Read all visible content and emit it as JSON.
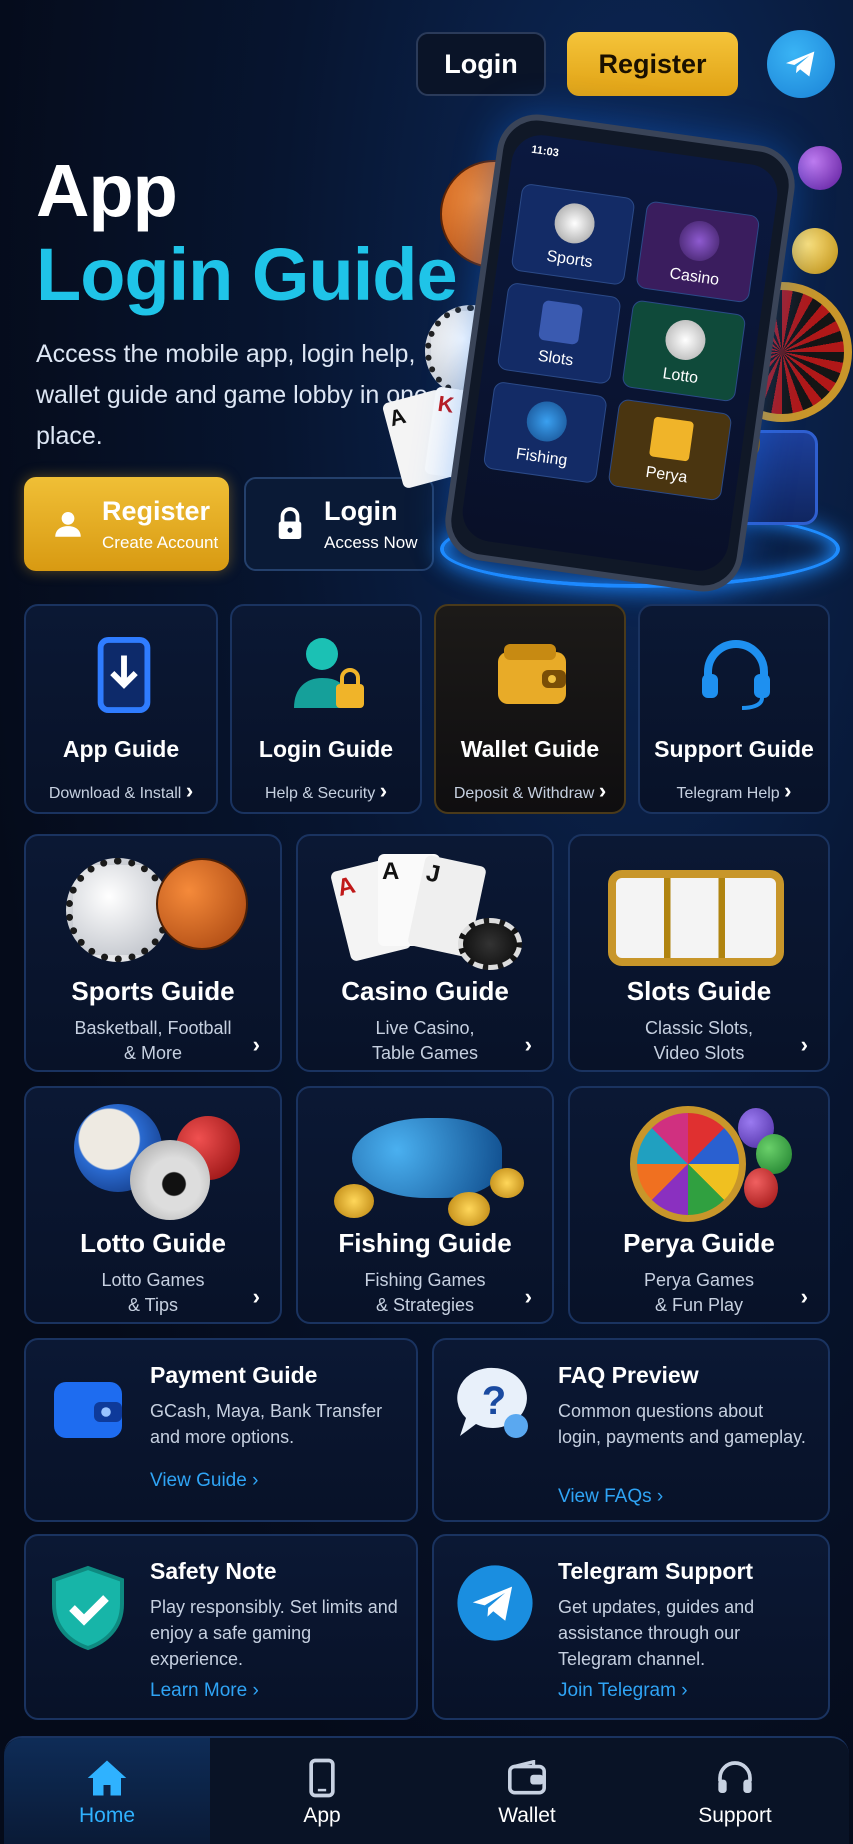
{
  "topbar": {
    "login_label": "Login",
    "register_label": "Register"
  },
  "hero": {
    "title_line1": "App",
    "title_line2": "Login Guide",
    "description": "Access the mobile app, login help, wallet guide and game lobby in one place.",
    "register_button": {
      "label": "Register",
      "sublabel": "Create Account"
    },
    "login_button": {
      "label": "Login",
      "sublabel": "Access Now"
    }
  },
  "phone": {
    "time": "11:03",
    "tiles": [
      "Sports",
      "Casino",
      "Slots",
      "Lotto",
      "Fishing",
      "Perya"
    ]
  },
  "guides_row1": [
    {
      "title": "App Guide",
      "sub": "Download & Install",
      "icon": "download-phone-icon",
      "color": "#1e6cf0"
    },
    {
      "title": "Login Guide",
      "sub": "Help & Security",
      "icon": "user-lock-icon",
      "color": "#17b5b0"
    },
    {
      "title": "Wallet Guide",
      "sub": "Deposit & Withdraw",
      "icon": "wallet-icon",
      "color": "#f0b429"
    },
    {
      "title": "Support Guide",
      "sub": "Telegram Help",
      "icon": "headset-icon",
      "color": "#1e90f0"
    }
  ],
  "guides_row2": [
    {
      "title": "Sports Guide",
      "sub": "Basketball, Football\n& More",
      "icon": "sports-balls-icon"
    },
    {
      "title": "Casino Guide",
      "sub": "Live Casino,\nTable Games",
      "icon": "playing-cards-icon"
    },
    {
      "title": "Slots Guide",
      "sub": "Classic Slots,\nVideo Slots",
      "icon": "slot-reels-icon"
    }
  ],
  "guides_row3": [
    {
      "title": "Lotto Guide",
      "sub": "Lotto Games\n& Tips",
      "icon": "lotto-balls-icon"
    },
    {
      "title": "Fishing Guide",
      "sub": "Fishing Games\n& Strategies",
      "icon": "fish-coins-icon"
    },
    {
      "title": "Perya Guide",
      "sub": "Perya Games\n& Fun Play",
      "icon": "color-wheel-icon"
    }
  ],
  "info_cards": [
    {
      "title": "Payment Guide",
      "text": "GCash, Maya, Bank Transfer and more options.",
      "link": "View Guide",
      "icon": "wallet-icon"
    },
    {
      "title": "FAQ Preview",
      "text": "Common questions about login, payments and gameplay.",
      "link": "View FAQs",
      "icon": "question-bubble-icon"
    },
    {
      "title": "Safety Note",
      "text": "Play responsibly. Set limits and enjoy a safe gaming experience.",
      "link": "Learn More",
      "icon": "shield-check-icon"
    },
    {
      "title": "Telegram Support",
      "text": "Get updates, guides and assistance through our Telegram channel.",
      "link": "Join Telegram",
      "icon": "telegram-icon"
    }
  ],
  "nav": [
    {
      "label": "Home",
      "icon": "home-icon",
      "active": true
    },
    {
      "label": "App",
      "icon": "phone-icon",
      "active": false
    },
    {
      "label": "Wallet",
      "icon": "wallet-icon",
      "active": false
    },
    {
      "label": "Support",
      "icon": "headset-icon",
      "active": false
    }
  ],
  "colors": {
    "accent_cyan": "#1fc4e8",
    "gold": "#f0b429",
    "link_blue": "#2fa4f5",
    "bg": "#060d1f"
  }
}
